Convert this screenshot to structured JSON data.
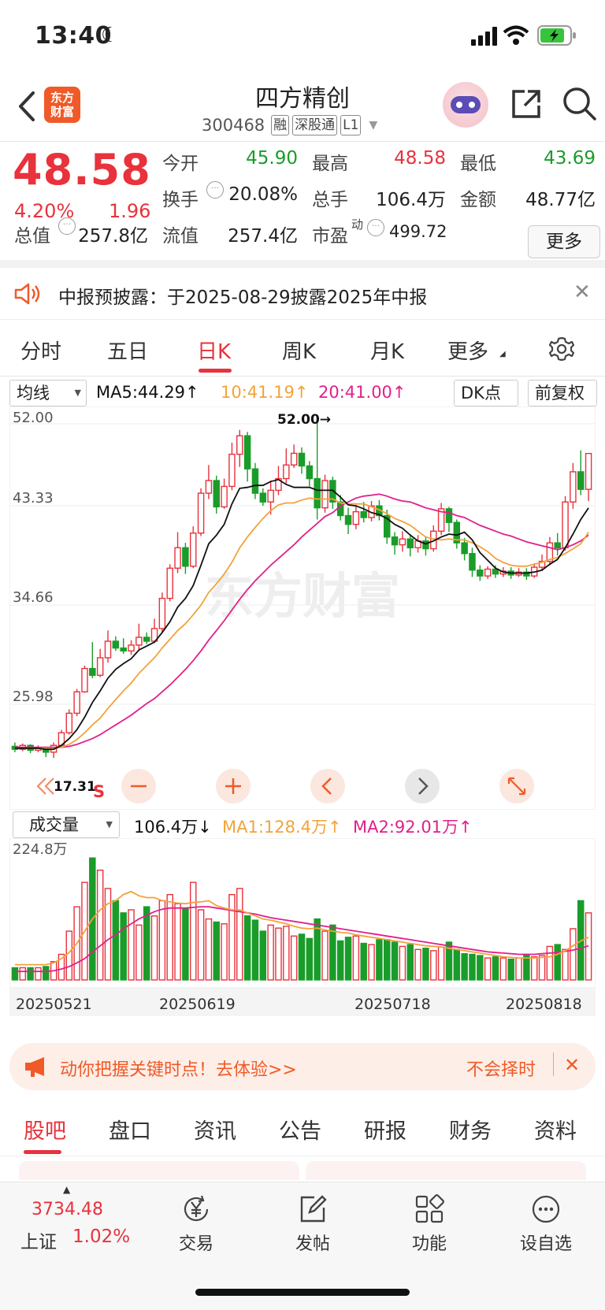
{
  "status_bar": {
    "time": "13:40"
  },
  "header": {
    "logo_text_top": "东方",
    "logo_text_bottom": "财富",
    "stock_name": "四方精创",
    "stock_code": "300468",
    "tags": [
      "融",
      "深股通",
      "L1"
    ]
  },
  "quote": {
    "price": "48.58",
    "change_pct": "4.20%",
    "change_amt": "1.96",
    "fields": {
      "open": {
        "label": "今开",
        "value": "45.90"
      },
      "high": {
        "label": "最高",
        "value": "48.58"
      },
      "low": {
        "label": "最低",
        "value": "43.69"
      },
      "turnover_rate": {
        "label": "换手",
        "value": "20.08%"
      },
      "total_hands": {
        "label": "总手",
        "value": "106.4万"
      },
      "amount": {
        "label": "金额",
        "value": "48.77亿"
      },
      "total_mv": {
        "label": "总值",
        "value": "257.8亿"
      },
      "float_mv": {
        "label": "流值",
        "value": "257.4亿"
      },
      "pe": {
        "label": "市盈",
        "sup": "动",
        "value": "499.72"
      }
    },
    "more_label": "更多"
  },
  "notice": {
    "text": "中报预披露：于2025-08-29披露2025年中报"
  },
  "period_tabs": {
    "items": [
      "分时",
      "五日",
      "日K",
      "周K",
      "月K",
      "更多"
    ],
    "active_index": 2
  },
  "ma_bar": {
    "select_label": "均线",
    "ma5": "MA5:44.29↑",
    "ma10": "10:41.19↑",
    "ma20": "20:41.00↑",
    "dk_label": "DK点",
    "adjust_label": "前复权"
  },
  "kline": {
    "y_labels": [
      "52.00",
      "43.33",
      "34.66",
      "25.98"
    ],
    "max_marker": "52.00→",
    "min_marker": "17.31",
    "s_marker": "S",
    "watermark": "东方财富",
    "ranges": {
      "y_min": 17.0,
      "y_max": 52.6
    }
  },
  "volume": {
    "select_label": "成交量",
    "current": "106.4万↓",
    "ma1": "MA1:128.4万↑",
    "ma2": "MA2:92.01万↑",
    "y_label": "224.8万",
    "y_max": 224.8
  },
  "dates": [
    "20250521",
    "20250619",
    "20250718",
    "20250818"
  ],
  "chart_data": {
    "type": "candlestick",
    "candles": [
      [
        18.5,
        18.2,
        18.9,
        17.9
      ],
      [
        18.2,
        18.6,
        18.8,
        18.0
      ],
      [
        18.6,
        18.1,
        18.7,
        17.8
      ],
      [
        18.1,
        18.3,
        18.6,
        17.9
      ],
      [
        18.3,
        17.9,
        18.4,
        17.4
      ],
      [
        17.9,
        18.6,
        18.9,
        17.31
      ],
      [
        18.6,
        19.9,
        20.2,
        18.5
      ],
      [
        19.9,
        21.9,
        22.3,
        19.7
      ],
      [
        21.9,
        24.1,
        24.4,
        21.6
      ],
      [
        24.1,
        26.5,
        26.8,
        24.0
      ],
      [
        26.5,
        25.8,
        29.2,
        25.5
      ],
      [
        25.8,
        27.6,
        28.5,
        25.6
      ],
      [
        27.6,
        29.3,
        30.4,
        27.1
      ],
      [
        29.3,
        28.6,
        29.8,
        28.3
      ],
      [
        28.6,
        28.3,
        29.6,
        28.0
      ],
      [
        28.3,
        28.9,
        29.4,
        27.9
      ],
      [
        28.9,
        29.7,
        31.1,
        28.4
      ],
      [
        29.7,
        29.3,
        30.2,
        29.0
      ],
      [
        29.3,
        30.6,
        31.6,
        29.1
      ],
      [
        30.6,
        33.7,
        34.3,
        30.2
      ],
      [
        33.7,
        36.8,
        37.2,
        33.4
      ],
      [
        36.8,
        38.9,
        40.5,
        36.3
      ],
      [
        38.9,
        37.0,
        39.4,
        36.2
      ],
      [
        37.0,
        40.4,
        41.1,
        36.8
      ],
      [
        40.4,
        44.5,
        45.0,
        40.1
      ],
      [
        44.5,
        45.8,
        47.4,
        43.9
      ],
      [
        45.8,
        43.1,
        46.3,
        42.4
      ],
      [
        43.1,
        45.2,
        46.0,
        42.9
      ],
      [
        45.2,
        48.5,
        49.7,
        44.8
      ],
      [
        48.5,
        50.4,
        51.0,
        47.2
      ],
      [
        50.4,
        47.0,
        50.8,
        45.7
      ],
      [
        47.0,
        44.5,
        47.6,
        43.9
      ],
      [
        44.5,
        43.6,
        45.0,
        43.2
      ],
      [
        43.6,
        44.8,
        45.8,
        42.3
      ],
      [
        44.8,
        46.0,
        47.3,
        44.3
      ],
      [
        46.0,
        47.4,
        49.1,
        45.5
      ],
      [
        47.4,
        48.6,
        49.5,
        47.1
      ],
      [
        48.6,
        47.3,
        49.2,
        46.5
      ],
      [
        47.3,
        46.0,
        47.8,
        45.2
      ],
      [
        46.0,
        43.0,
        52.0,
        41.8
      ],
      [
        43.0,
        45.8,
        46.4,
        42.5
      ],
      [
        45.8,
        43.6,
        46.2,
        42.9
      ],
      [
        43.6,
        42.2,
        44.3,
        41.7
      ],
      [
        42.2,
        41.3,
        43.0,
        40.3
      ],
      [
        41.3,
        42.6,
        43.3,
        40.8
      ],
      [
        42.6,
        42.0,
        43.6,
        41.5
      ],
      [
        42.0,
        43.2,
        43.7,
        41.6
      ],
      [
        43.2,
        42.2,
        43.8,
        41.7
      ],
      [
        42.2,
        40.0,
        42.8,
        39.3
      ],
      [
        40.0,
        39.2,
        40.5,
        38.2
      ],
      [
        39.2,
        39.8,
        40.6,
        38.5
      ],
      [
        39.8,
        38.9,
        40.3,
        38.0
      ],
      [
        38.9,
        39.6,
        40.2,
        38.4
      ],
      [
        39.6,
        38.8,
        40.1,
        38.1
      ],
      [
        38.8,
        40.6,
        41.2,
        38.5
      ],
      [
        40.6,
        42.9,
        43.5,
        40.2
      ],
      [
        42.9,
        41.5,
        43.1,
        40.5
      ],
      [
        41.5,
        39.4,
        41.8,
        38.8
      ],
      [
        39.4,
        38.3,
        39.9,
        37.6
      ],
      [
        38.3,
        36.6,
        38.9,
        35.9
      ],
      [
        36.6,
        36.0,
        37.1,
        35.5
      ],
      [
        36.0,
        36.7,
        37.0,
        35.7
      ],
      [
        36.7,
        36.2,
        37.1,
        35.8
      ],
      [
        36.2,
        36.5,
        36.9,
        35.9
      ],
      [
        36.5,
        36.1,
        36.9,
        35.7
      ],
      [
        36.1,
        36.4,
        36.8,
        35.9
      ],
      [
        36.4,
        36.0,
        36.8,
        35.6
      ],
      [
        36.0,
        36.9,
        37.3,
        35.8
      ],
      [
        36.9,
        37.5,
        38.2,
        36.5
      ],
      [
        37.5,
        39.4,
        40.0,
        37.1
      ],
      [
        39.4,
        38.9,
        40.4,
        38.1
      ],
      [
        38.9,
        43.6,
        44.2,
        38.6
      ],
      [
        43.6,
        46.7,
        47.6,
        42.9
      ],
      [
        46.7,
        44.9,
        48.9,
        44.3
      ],
      [
        44.9,
        48.58,
        48.58,
        43.69
      ]
    ],
    "ma5": [
      18.3,
      18.3,
      18.3,
      18.3,
      18.2,
      18.2,
      18.6,
      19.3,
      20.2,
      21.5,
      23.0,
      24.2,
      25.5,
      26.4,
      27.0,
      27.5,
      28.4,
      28.8,
      29.2,
      30.2,
      31.3,
      32.8,
      33.7,
      35.0,
      37.1,
      39.3,
      40.2,
      41.3,
      43.4,
      45.0,
      45.1,
      45.3,
      45.3,
      45.7,
      45.9,
      45.4,
      45.1,
      45.1,
      45.1,
      44.8,
      44.8,
      44.8,
      44.1,
      43.3,
      43.2,
      42.9,
      42.5,
      42.3,
      41.9,
      41.3,
      40.9,
      40.2,
      39.6,
      39.3,
      39.6,
      40.0,
      40.3,
      40.2,
      40.5,
      39.7,
      38.4,
      37.6,
      36.8,
      36.4,
      36.3,
      36.3,
      36.3,
      36.4,
      36.6,
      37.2,
      37.7,
      38.9,
      40.3,
      41.8,
      43.0
    ],
    "ma10": [
      18.3,
      18.3,
      18.3,
      18.3,
      18.3,
      18.3,
      18.4,
      18.7,
      19.2,
      19.9,
      20.7,
      21.4,
      22.4,
      23.3,
      24.2,
      25.0,
      26.0,
      26.8,
      27.6,
      28.6,
      29.5,
      30.4,
      31.1,
      32.0,
      33.0,
      34.3,
      35.2,
      36.2,
      37.4,
      38.9,
      40.0,
      41.0,
      41.9,
      42.7,
      43.3,
      43.5,
      43.5,
      43.8,
      44.0,
      43.9,
      43.9,
      43.9,
      43.5,
      43.4,
      43.4,
      43.4,
      43.1,
      42.8,
      42.4,
      41.9,
      41.6,
      41.2,
      40.6,
      40.0,
      39.8,
      39.7,
      39.8,
      39.7,
      39.7,
      39.4,
      39.0,
      38.5,
      37.8,
      37.4,
      37.1,
      37.0,
      37.0,
      37.2,
      37.4,
      37.7,
      37.9,
      38.3,
      38.8,
      39.3,
      40.5
    ],
    "ma20": [
      18.4,
      18.4,
      18.4,
      18.4,
      18.4,
      18.4,
      18.4,
      18.5,
      18.7,
      19.0,
      19.3,
      19.7,
      20.2,
      20.7,
      21.2,
      21.7,
      22.3,
      22.9,
      23.4,
      24.1,
      24.8,
      25.6,
      26.4,
      27.3,
      28.3,
      29.4,
      30.4,
      31.4,
      32.5,
      33.6,
      34.6,
      35.5,
      36.3,
      37.1,
      37.8,
      38.5,
      39.2,
      40.0,
      40.7,
      41.4,
      42.1,
      42.5,
      43.2,
      43.6,
      44.0,
      44.2,
      44.3,
      44.4,
      44.2,
      43.9,
      43.7,
      43.6,
      43.3,
      43.0,
      42.8,
      42.6,
      42.5,
      42.2,
      42.0,
      41.6,
      41.2,
      40.9,
      40.6,
      40.3,
      40.1,
      39.8,
      39.5,
      39.3,
      39.1,
      38.9,
      38.7,
      38.9,
      39.2,
      39.6,
      40.2
    ],
    "volumes": [
      20,
      20,
      20,
      20,
      22,
      30,
      42,
      80,
      120,
      160,
      200,
      180,
      150,
      130,
      110,
      115,
      90,
      120,
      105,
      130,
      140,
      125,
      118,
      160,
      115,
      100,
      95,
      92,
      140,
      150,
      105,
      98,
      80,
      90,
      85,
      88,
      72,
      75,
      68,
      100,
      80,
      90,
      64,
      70,
      72,
      60,
      58,
      66,
      66,
      62,
      55,
      58,
      50,
      52,
      48,
      54,
      62,
      50,
      43,
      42,
      40,
      36,
      38,
      36,
      34,
      36,
      42,
      38,
      40,
      55,
      58,
      50,
      84,
      130,
      110
    ],
    "vol_ma1": [
      25,
      25,
      25,
      25,
      25,
      28,
      35,
      45,
      60,
      80,
      100,
      115,
      125,
      130,
      140,
      145,
      138,
      135,
      135,
      130,
      128,
      126,
      125,
      127,
      128,
      130,
      122,
      118,
      115,
      115,
      110,
      105,
      100,
      98,
      95,
      92,
      88,
      85,
      84,
      85,
      82,
      80,
      78,
      77,
      74,
      72,
      70,
      68,
      66,
      64,
      62,
      60,
      58,
      56,
      55,
      54,
      52,
      50,
      48,
      46,
      44,
      42,
      40,
      38,
      37,
      36,
      36,
      36,
      37,
      38,
      42,
      48,
      56,
      64,
      70
    ],
    "vol_ma2": [
      14,
      14,
      14,
      14,
      14,
      15,
      18,
      22,
      28,
      35,
      46,
      56,
      66,
      74,
      84,
      92,
      100,
      106,
      112,
      116,
      118,
      118,
      118,
      119,
      120,
      120,
      118,
      116,
      114,
      112,
      110,
      108,
      105,
      102,
      100,
      98,
      96,
      94,
      92,
      90,
      88,
      86,
      84,
      82,
      80,
      78,
      76,
      74,
      72,
      70,
      68,
      66,
      64,
      62,
      60,
      58,
      56,
      54,
      52,
      50,
      48,
      46,
      45,
      44,
      43,
      42,
      42,
      42,
      43,
      44,
      45,
      47,
      49,
      52,
      56
    ]
  },
  "ad_banner": {
    "text": "动你把握关键时点！去体验>>",
    "right_text": "不会择时"
  },
  "content_tabs": [
    "股吧",
    "盘口",
    "资讯",
    "公告",
    "研报",
    "财务",
    "资料"
  ],
  "bottom_nav": {
    "index_value": "3734.48",
    "index_name": "上证",
    "index_pct": "1.02%",
    "items": [
      "交易",
      "发帖",
      "功能",
      "设自选"
    ]
  }
}
